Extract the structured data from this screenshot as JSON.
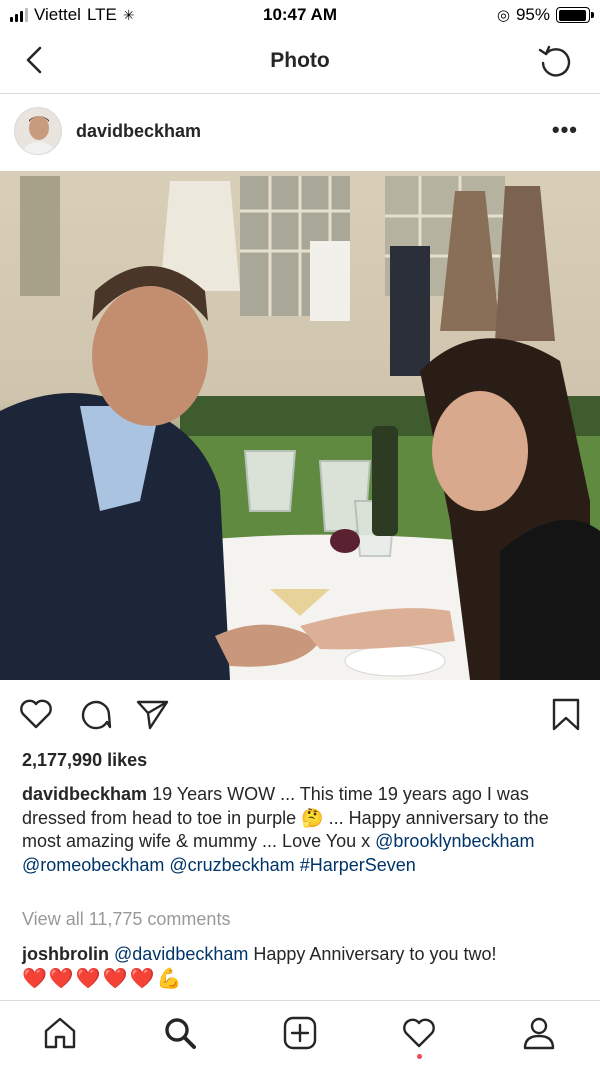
{
  "status_bar": {
    "carrier": "Viettel",
    "network": "LTE",
    "time": "10:47 AM",
    "battery_percent": "95%",
    "battery_level": 0.95
  },
  "nav": {
    "title": "Photo",
    "back_icon": "chevron-left-icon",
    "refresh_icon": "refresh-icon"
  },
  "post": {
    "username": "davidbeckham",
    "more_label": "•••",
    "likes": "2,177,990 likes",
    "caption": {
      "username": "davidbeckham",
      "text_1": " 19 Years WOW ... This time 19 years ago I was dressed from head to toe in purple ",
      "emoji": "🤔",
      "text_2": " ... Happy anniversary to the most amazing wife & mummy ... Love You x ",
      "mention_1": "@brooklynbeckham",
      "mention_2": "@romeobeckham",
      "mention_3": "@cruzbeckham",
      "hashtag": "#HarperSeven"
    },
    "view_comments": "View all 11,775 comments",
    "comment": {
      "username": "joshbrolin",
      "mention": "@davidbeckham",
      "text": " Happy Anniversary to you two!",
      "emojis": "❤️❤️❤️❤️❤️💪"
    }
  },
  "tabbar": {
    "items": [
      "home-icon",
      "search-icon",
      "new-post-icon",
      "activity-icon",
      "profile-icon"
    ],
    "active": "search-icon"
  },
  "colors": {
    "link": "#003569",
    "muted": "#999999",
    "text": "#262626",
    "border": "#dbdbdb",
    "notification": "#ed4956"
  }
}
